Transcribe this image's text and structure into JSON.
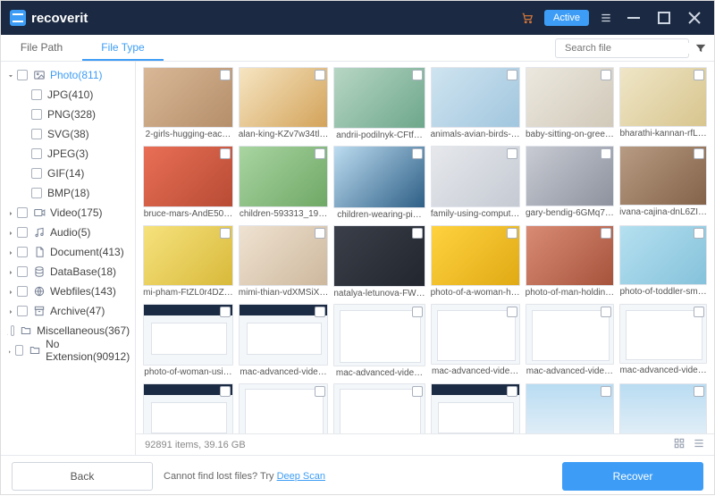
{
  "brand": {
    "name": "recoverit"
  },
  "titlebar": {
    "active_label": "Active"
  },
  "tabs": {
    "file_path": "File Path",
    "file_type": "File Type"
  },
  "search": {
    "placeholder": "Search file"
  },
  "tree": {
    "photo": {
      "label": "Photo(811)",
      "children": [
        {
          "label": "JPG(410)"
        },
        {
          "label": "PNG(328)"
        },
        {
          "label": "SVG(38)"
        },
        {
          "label": "JPEG(3)"
        },
        {
          "label": "GIF(14)"
        },
        {
          "label": "BMP(18)"
        }
      ]
    },
    "video": {
      "label": "Video(175)"
    },
    "audio": {
      "label": "Audio(5)"
    },
    "document": {
      "label": "Document(413)"
    },
    "database": {
      "label": "DataBase(18)"
    },
    "webfiles": {
      "label": "Webfiles(143)"
    },
    "archive": {
      "label": "Archive(47)"
    },
    "misc": {
      "label": "Miscellaneous(367)"
    },
    "noext": {
      "label": "No Extension(90912)"
    }
  },
  "files": [
    {
      "name": "2-girls-hugging-eac…",
      "thcls": "th-p1"
    },
    {
      "name": "alan-king-KZv7w34tl…",
      "thcls": "th-p2"
    },
    {
      "name": "andrii-podilnyk-CFtf…",
      "thcls": "th-p3"
    },
    {
      "name": "animals-avian-birds-…",
      "thcls": "th-p4"
    },
    {
      "name": "baby-sitting-on-gree…",
      "thcls": "th-p5"
    },
    {
      "name": "bharathi-kannan-rfL…",
      "thcls": "th-p6"
    },
    {
      "name": "bruce-mars-AndE50…",
      "thcls": "th-p7"
    },
    {
      "name": "children-593313_19…",
      "thcls": "th-p8"
    },
    {
      "name": "children-wearing-pi…",
      "thcls": "th-p9"
    },
    {
      "name": "family-using-comput…",
      "thcls": "th-p10"
    },
    {
      "name": "gary-bendig-6GMq7…",
      "thcls": "th-p11"
    },
    {
      "name": "ivana-cajina-dnL6ZI…",
      "thcls": "th-p12"
    },
    {
      "name": "mi-pham-FtZL0r4DZ…",
      "thcls": "th-p13"
    },
    {
      "name": "mimi-thian-vdXMSiX…",
      "thcls": "th-p14"
    },
    {
      "name": "natalya-letunova-FW…",
      "thcls": "th-p15"
    },
    {
      "name": "photo-of-a-woman-h…",
      "thcls": "th-p16"
    },
    {
      "name": "photo-of-man-holdin…",
      "thcls": "th-p17"
    },
    {
      "name": "photo-of-toddler-sm…",
      "thcls": "th-p18"
    },
    {
      "name": "photo-of-woman-usi…",
      "thcls": "th-ui"
    },
    {
      "name": "mac-advanced-vide…",
      "thcls": "th-ui"
    },
    {
      "name": "mac-advanced-vide…",
      "thcls": "th-ui2"
    },
    {
      "name": "mac-advanced-vide…",
      "thcls": "th-ui2"
    },
    {
      "name": "mac-advanced-vide…",
      "thcls": "th-ui2"
    },
    {
      "name": "mac-advanced-vide…",
      "thcls": "th-ui2"
    },
    {
      "name": "",
      "thcls": "th-ui"
    },
    {
      "name": "",
      "thcls": "th-ui2"
    },
    {
      "name": "",
      "thcls": "th-ui2"
    },
    {
      "name": "",
      "thcls": "th-ui"
    },
    {
      "name": "",
      "thcls": "th-sky"
    },
    {
      "name": "",
      "thcls": "th-sky"
    }
  ],
  "status": {
    "summary": "92891 items, 39.16  GB"
  },
  "footer": {
    "back": "Back",
    "hint_pre": "Cannot find lost files? Try ",
    "hint_link": "Deep Scan",
    "recover": "Recover"
  }
}
